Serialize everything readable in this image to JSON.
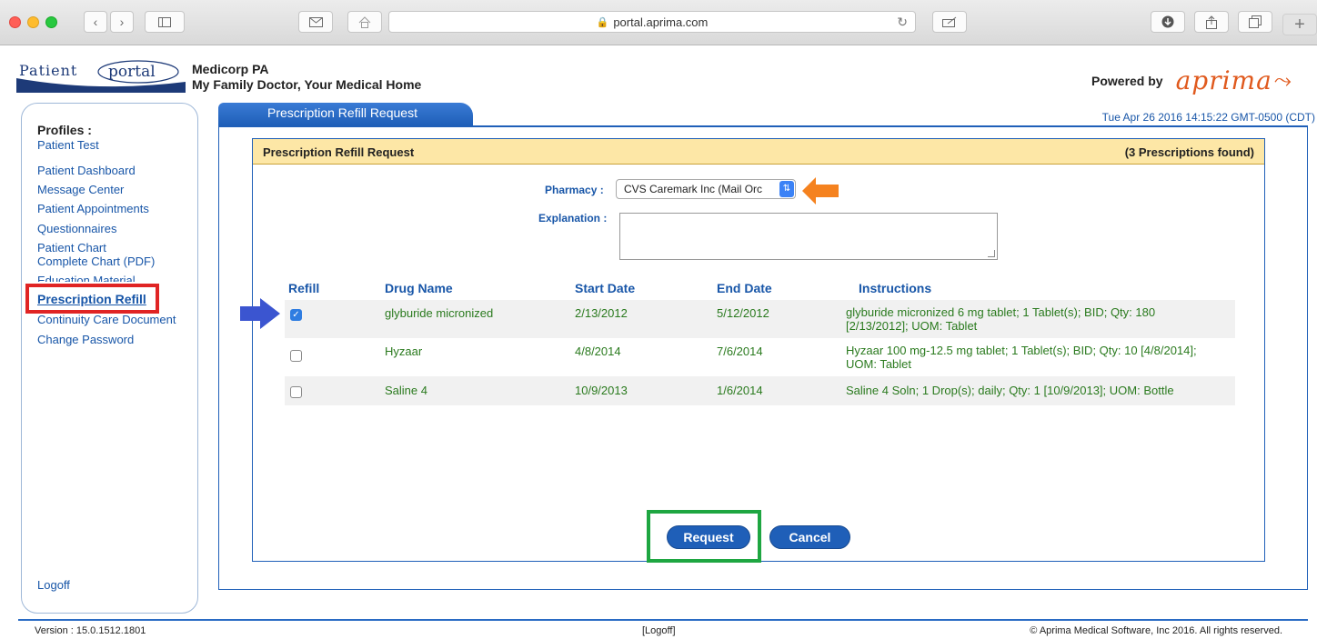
{
  "browser": {
    "url": "portal.aprima.com"
  },
  "header": {
    "logo_word1": "Patient",
    "logo_word2": "portal",
    "org_name": "Medicorp PA",
    "org_tagline": "My Family Doctor, Your Medical Home",
    "powered_by": "Powered by",
    "brand": "aprima"
  },
  "sidebar": {
    "profiles_label": "Profiles :",
    "profile_name": "Patient Test",
    "items": [
      {
        "label": "Patient Dashboard"
      },
      {
        "label": "Message Center"
      },
      {
        "label": "Patient Appointments"
      },
      {
        "label": "Questionnaires"
      },
      {
        "label": "Patient Chart"
      },
      {
        "label": "Complete Chart (PDF)"
      },
      {
        "label": "Education Material"
      },
      {
        "label": "Prescription Refill"
      },
      {
        "label": "Continuity Care Document"
      },
      {
        "label": "Change Password"
      }
    ],
    "logoff": "Logoff"
  },
  "main": {
    "tab_label": "Prescription Refill Request",
    "timestamp": "Tue Apr 26 2016 14:15:22 GMT-0500 (CDT)",
    "panel_title": "Prescription Refill Request",
    "found_count": "(3 Prescriptions found)",
    "pharmacy_label": "Pharmacy :",
    "pharmacy_value": "CVS Caremark Inc (Mail Orc",
    "explanation_label": "Explanation :",
    "explanation_value": "",
    "columns": {
      "refill": "Refill",
      "drug": "Drug Name",
      "start": "Start Date",
      "end": "End Date",
      "instructions": "Instructions"
    },
    "rows": [
      {
        "checked": true,
        "drug": "glyburide micronized",
        "start": "2/13/2012",
        "end": "5/12/2012",
        "instr1": "glyburide micronized 6 mg tablet; 1 Tablet(s); BID; Qty: 180",
        "instr2": "[2/13/2012]; UOM: Tablet"
      },
      {
        "checked": false,
        "drug": "Hyzaar",
        "start": "4/8/2014",
        "end": "7/6/2014",
        "instr1": "Hyzaar 100 mg-12.5 mg tablet; 1 Tablet(s); BID; Qty: 10 [4/8/2014];",
        "instr2": "UOM: Tablet"
      },
      {
        "checked": false,
        "drug": "Saline 4",
        "start": "10/9/2013",
        "end": "1/6/2014",
        "instr1": "Saline 4 Soln; 1 Drop(s); daily; Qty: 1 [10/9/2013]; UOM: Bottle",
        "instr2": ""
      }
    ],
    "request_button": "Request",
    "cancel_button": "Cancel"
  },
  "footer": {
    "version": "Version  :  15.0.1512.1801",
    "logoff": "[Logoff]",
    "copyright": "© Aprima Medical Software, Inc 2016. All rights reserved."
  },
  "colors": {
    "link_blue": "#1856a8",
    "accent_blue": "#1f5fb8",
    "header_yellow": "#fde7a6",
    "drug_green": "#2a7a1e",
    "annotation_red": "#e02424",
    "annotation_orange": "#f5821f",
    "annotation_blue": "#3b55d0",
    "annotation_green": "#1ea641"
  }
}
